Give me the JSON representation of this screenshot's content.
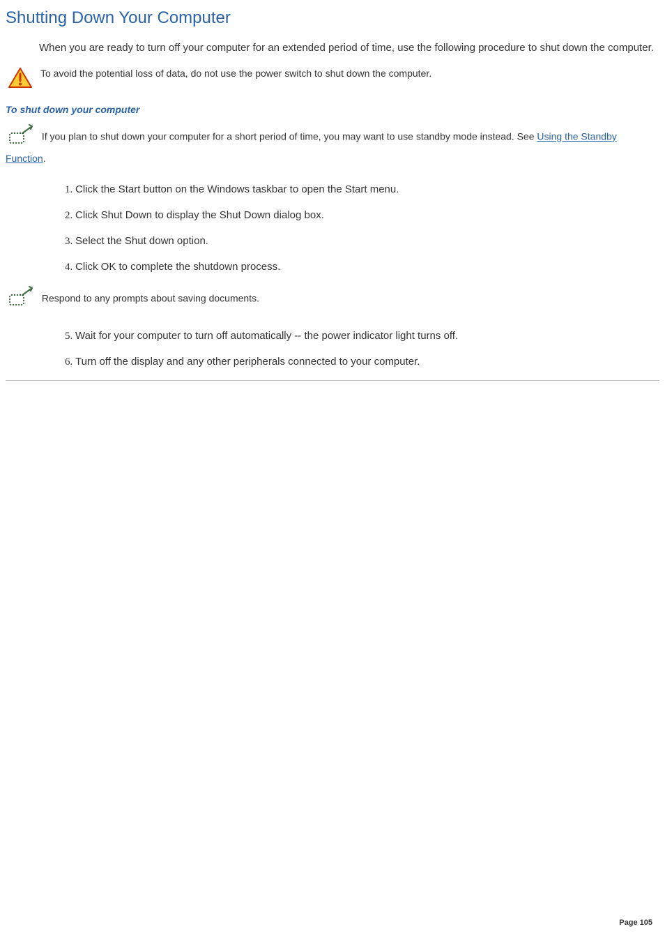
{
  "title": "Shutting Down Your Computer",
  "intro": "When you are ready to turn off your computer for an extended period of time, use the following procedure to shut down the computer.",
  "warning": "To avoid the potential loss of data, do not use the power switch to shut down the computer.",
  "subheading": "To shut down your computer",
  "note1_prefix": "  If you plan to shut down your computer for a short period of time, you may want to use standby mode instead. See ",
  "note1_link": "Using the Standby Function",
  "note1_suffix": ".",
  "steps_a": [
    "Click the Start button on the Windows  taskbar to open the Start menu.",
    "Click Shut Down to display the Shut Down dialog box.",
    "Select the Shut down option.",
    "Click OK to complete the shutdown process."
  ],
  "note2": "  Respond to any prompts about saving documents.",
  "steps_b": [
    "Wait for your computer to turn off automatically -- the power indicator light turns off.",
    "Turn off the display and any other peripherals connected to your computer."
  ],
  "page_label": "Page 105"
}
